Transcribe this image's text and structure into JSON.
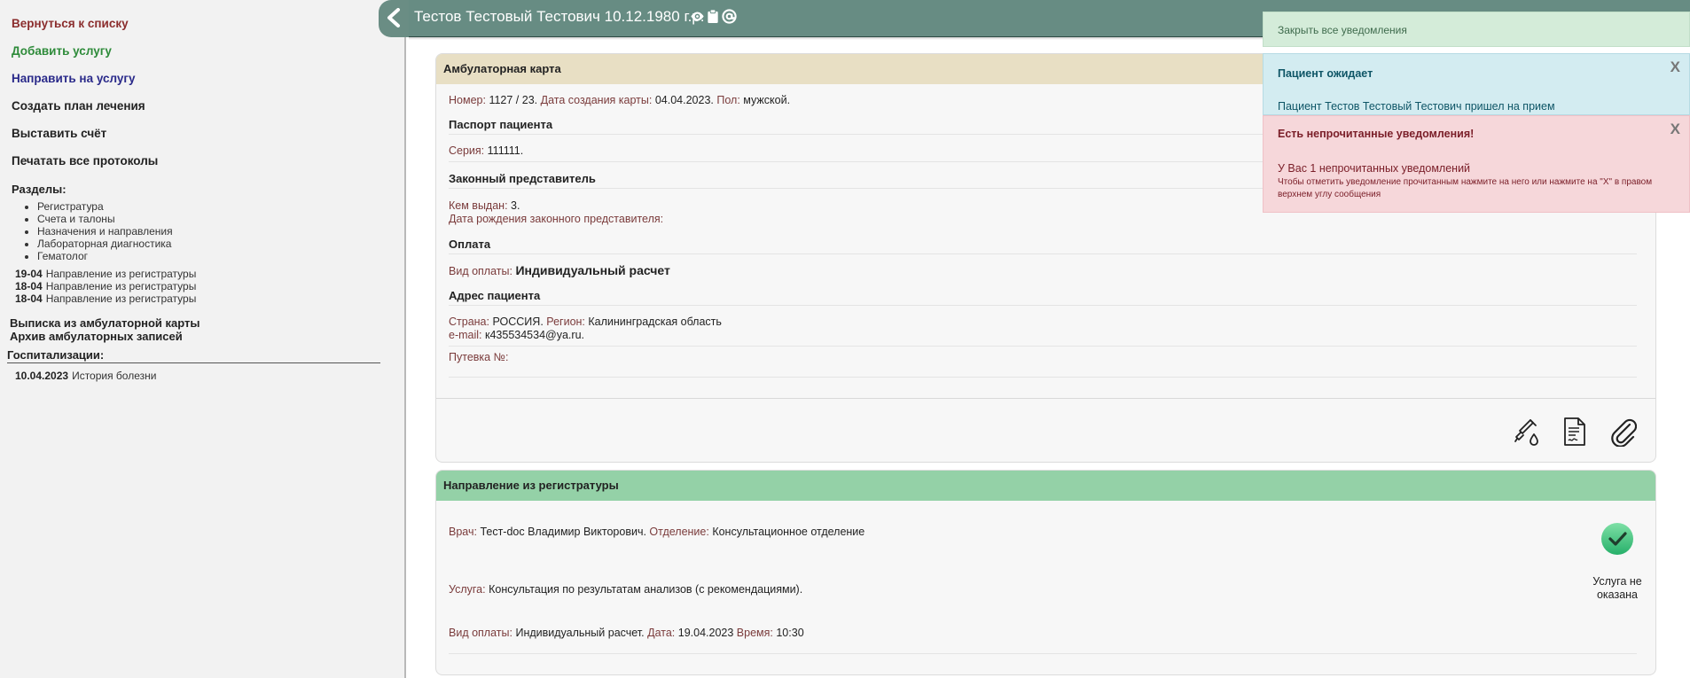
{
  "sidebar": {
    "back_link": "Вернуться к списку",
    "add_service": "Добавить услугу",
    "refer_service": "Направить на услугу",
    "create_plan": "Создать план лечения",
    "invoice": "Выставить счёт",
    "print_all": "Печатать все протоколы",
    "sections_title": "Разделы:",
    "sections": [
      "Регистратура",
      "Счета и талоны",
      "Назначения и направления",
      "Лабораторная диагностика",
      "Гематолог"
    ],
    "referrals": [
      {
        "date": "19-04",
        "label": "Направление из регистратуры"
      },
      {
        "date": "18-04",
        "label": "Направление из регистратуры"
      },
      {
        "date": "18-04",
        "label": "Направление из регистратуры"
      }
    ],
    "extract": "Выписка из амбулаторной карты",
    "archive": "Архив амбулаторных записей",
    "hosp_title": "Госпитализации:",
    "hosp_row": {
      "date": "10.04.2023",
      "label": "История болезни"
    },
    "colors": {
      "back": "#8b2d2d",
      "add": "#2e8b3a",
      "refer": "#2a2a8a",
      "default": "#222222"
    }
  },
  "header": {
    "title": "Тестов Тестовый Тестович 10.12.1980 г.р.",
    "icons": [
      "eye-icon",
      "clipboard-icon",
      "at-icon"
    ],
    "color": "#678c83"
  },
  "card_ambulatory": {
    "title": "Амбулаторная карта",
    "number_label": "Номер:",
    "number": "1127 / 23.",
    "created_label": "Дата создания карты:",
    "created": "04.04.2023.",
    "sex_label": "Пол:",
    "sex": "мужской.",
    "passport_title": "Паспорт пациента",
    "series_label": "Серия:",
    "series": "111111.",
    "guardian_title": "Законный представитель",
    "issued_label": "Кем выдан:",
    "issued": "3.",
    "guardian_birth_label": "Дата рождения законного представителя:",
    "payment_title": "Оплата",
    "payment_type_label": "Вид оплаты:",
    "payment_type": "Индивидуальный расчет",
    "address_title": "Адрес пациента",
    "country_label": "Страна:",
    "country": "РОССИЯ.",
    "region_label": "Регион:",
    "region": "Калининградская область",
    "email_label": "e-mail:",
    "email": "к435534534@ya.ru.",
    "voucher_label": "Путевка №:",
    "tools": [
      "syringe-drop-icon",
      "document-signature-icon",
      "paperclip-icon"
    ],
    "head_color": "#e8dfc4"
  },
  "card_referral": {
    "title": "Направление из регистратуры",
    "doctor_label": "Врач:",
    "doctor": "Тест-doc Владимир Викторович.",
    "department_label": "Отделение:",
    "department": "Консультационное отделение",
    "service_label": "Услуга:",
    "service": "Консультация по результатам анализов (с рекомендациями).",
    "payment_label": "Вид оплаты:",
    "payment": "Индивидуальный расчет.",
    "date_label": "Дата:",
    "date": "19.04.2023",
    "time_label": "Время:",
    "time": "10:30",
    "status_line1": "Услуга не",
    "status_line2": "оказана",
    "head_color": "#94d1a7"
  },
  "notifications": {
    "close_all": "Закрыть все уведомления",
    "waiting_title": "Пациент ожидает",
    "waiting_text": "Пациент Тестов Тестовый Тестович пришел на прием",
    "unread_title": "Есть непрочитанные уведомления!",
    "unread_text": "У Вас 1 непрочитанных уведомлений",
    "unread_hint": "Чтобы отметить уведомление прочитанным нажмите на него или нажмите на \"X\" в правом верхнем углу сообщения",
    "close_x": "X"
  }
}
